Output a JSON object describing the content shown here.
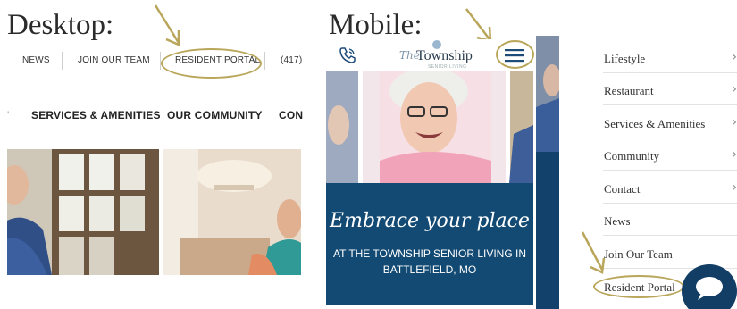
{
  "headings": {
    "desktop": "Desktop:",
    "mobile": "Mobile:"
  },
  "desktop": {
    "topnav": [
      "NEWS",
      "JOIN OUR TEAM",
      "RESIDENT PORTAL",
      "(417)"
    ],
    "mainnav": [
      "'",
      "SERVICES & AMENITIES",
      "OUR COMMUNITY",
      "CON"
    ]
  },
  "mobile": {
    "logo_script": "The",
    "logo_name": "Township",
    "logo_tagline": "SENIOR LIVING",
    "banner_script": "Embrace your place",
    "banner_line1": "AT THE TOWNSHIP SENIOR LIVING IN",
    "banner_line2": "BATTLEFIELD, MO"
  },
  "menu": {
    "items": [
      {
        "label": "Lifestyle",
        "has_sub": true
      },
      {
        "label": "Restaurant",
        "has_sub": true
      },
      {
        "label": "Services & Amenities",
        "has_sub": true
      },
      {
        "label": "Community",
        "has_sub": true
      },
      {
        "label": "Contact",
        "has_sub": true
      },
      {
        "label": "News",
        "has_sub": false
      },
      {
        "label": "Join Our Team",
        "has_sub": false
      },
      {
        "label": "Resident Portal",
        "has_sub": false
      }
    ],
    "chevron": "›"
  },
  "colors": {
    "highlight": "#b9a65a",
    "brand_blue": "#134a73"
  },
  "icons": [
    "phone-icon",
    "hamburger-menu-icon",
    "chat-bubble-icon",
    "chevron-right-icon",
    "arrow-annotation-icon"
  ]
}
